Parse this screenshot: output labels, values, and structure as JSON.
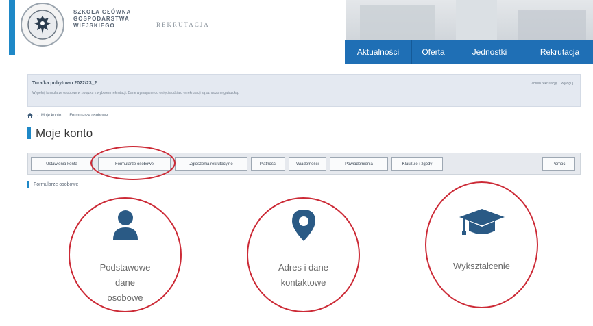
{
  "header": {
    "university_lines": [
      "SZKOŁA GŁÓWNA",
      "GOSPODARSTWA",
      "WIEJSKIEGO"
    ],
    "section_label": "REKRUTACJA",
    "logo_icon": "eagle-emblem-icon"
  },
  "nav": {
    "items": [
      {
        "label": "Aktualności"
      },
      {
        "label": "Oferta"
      },
      {
        "label": "Jednostki"
      },
      {
        "label": "Rekrutacja"
      }
    ]
  },
  "info": {
    "title": "Tura/ka pobytowo 2022/23_2",
    "subtitle": "Wypełnij formularze osobowe w związku z wyborem rekrutacji. Dane wymagane do wzięcia udziału w rekrutacji są oznaczone gwiazdką.",
    "links": [
      "Zmień rekrutację",
      "Wyloguj"
    ]
  },
  "breadcrumb": {
    "items": [
      "Moje konto",
      "Formularze osobowe"
    ],
    "separator": "→"
  },
  "page": {
    "title": "Moje konto"
  },
  "tabs": [
    {
      "label": "Ustawienia konta"
    },
    {
      "label": "Formularze osobowe",
      "active": true
    },
    {
      "label": "Zgłoszenia rekrutacyjne"
    },
    {
      "label": "Płatności"
    },
    {
      "label": "Wiadomości"
    },
    {
      "label": "Powiadomienia"
    },
    {
      "label": "Klauzule i zgody"
    },
    {
      "label": "Pomoc"
    }
  ],
  "section": {
    "title": "Formularze osobowe"
  },
  "cards": [
    {
      "label_lines": [
        "Podstawowe",
        "dane",
        "osobowe"
      ],
      "icon": "user-icon"
    },
    {
      "label_lines": [
        "Adres i dane",
        "kontaktowe"
      ],
      "icon": "location-pin-icon"
    },
    {
      "label_lines": [
        "Wykształcenie"
      ],
      "icon": "graduation-cap-icon"
    }
  ],
  "colors": {
    "accent": "#1e88c7",
    "nav": "#1f6fb5",
    "icon": "#2a5a85",
    "highlight_circle": "#cc2a36"
  }
}
